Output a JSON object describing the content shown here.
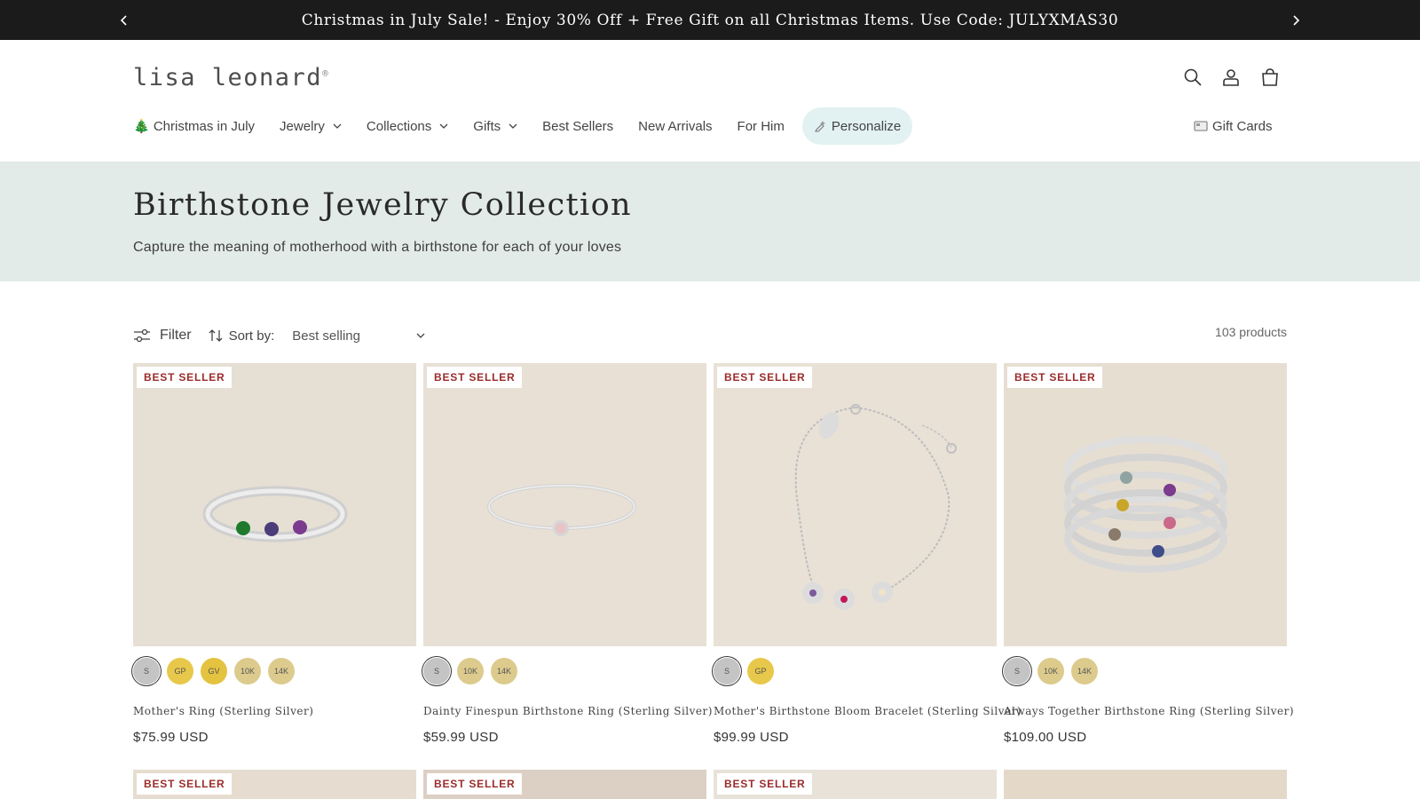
{
  "announcement": {
    "message": "Christmas in July Sale! - Enjoy 30% Off + Free Gift on all Christmas Items. Use Code: JULYXMAS30"
  },
  "header": {
    "logo_text": "lisa leonard",
    "logo_mark": "®"
  },
  "nav": {
    "items": [
      {
        "label": "🎄 Christmas in July"
      },
      {
        "label": "Jewelry"
      },
      {
        "label": "Collections"
      },
      {
        "label": "Gifts"
      },
      {
        "label": "Best Sellers"
      },
      {
        "label": "New Arrivals"
      },
      {
        "label": "For Him"
      },
      {
        "label": "Personalize"
      }
    ],
    "gift_cards": "Gift Cards"
  },
  "banner": {
    "title": "Birthstone Jewelry Collection",
    "subtitle": "Capture the meaning of motherhood with a birthstone for each of your loves"
  },
  "toolbar": {
    "filter_label": "Filter",
    "sort_label": "Sort by:",
    "sort_value": "Best selling",
    "product_count": "103 products"
  },
  "products": [
    {
      "badge": "BEST SELLER",
      "title": "Mother's Ring (Sterling Silver)",
      "price": "$75.99 USD",
      "swatches": [
        "S",
        "GP",
        "GV",
        "10K",
        "14K"
      ]
    },
    {
      "badge": "BEST SELLER",
      "title": "Dainty Finespun Birthstone Ring (Sterling Silver)",
      "price": "$59.99 USD",
      "swatches": [
        "S",
        "10K",
        "14K"
      ]
    },
    {
      "badge": "BEST SELLER",
      "title": "Mother's Birthstone Bloom Bracelet (Sterling Silver)",
      "price": "$99.99 USD",
      "swatches": [
        "S",
        "GP"
      ]
    },
    {
      "badge": "BEST SELLER",
      "title": "Always Together Birthstone Ring (Sterling Silver)",
      "price": "$109.00 USD",
      "swatches": [
        "S",
        "10K",
        "14K"
      ]
    }
  ],
  "next_row_badges": [
    "BEST SELLER",
    "BEST SELLER",
    "BEST SELLER"
  ],
  "colors": {
    "announcement_bg": "#1b1b1b",
    "banner_bg": "#e2ebe8",
    "personalize_pill": "#e2f1f2",
    "badge_text": "#9b2b2b",
    "silver_swatch": "#c4c4c4",
    "gold_plated_swatch": "#e8c84a",
    "gold_vermeil_swatch": "#e3c340",
    "karat_gold_swatch": "#dccb8c"
  },
  "icons": [
    "chevron-left-icon",
    "chevron-right-icon",
    "search-icon",
    "account-icon",
    "cart-icon",
    "chevron-down-icon",
    "filter-icon",
    "sort-icon",
    "tree-icon",
    "personalize-icon",
    "gift-card-icon"
  ]
}
